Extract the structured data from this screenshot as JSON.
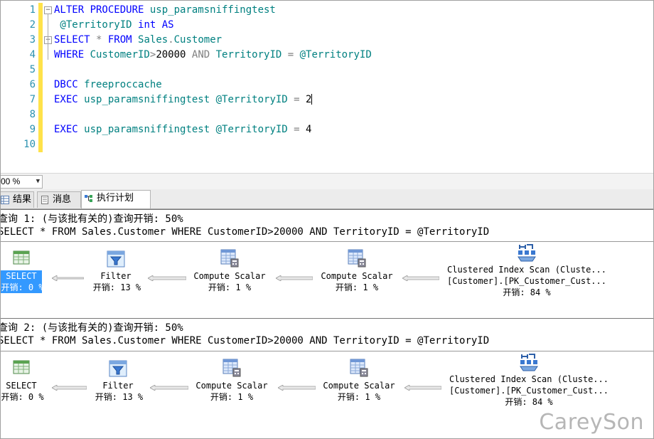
{
  "editor": {
    "line_numbers": [
      "1",
      "2",
      "3",
      "4",
      "5",
      "6",
      "7",
      "8",
      "9",
      "10"
    ],
    "lines": [
      [
        {
          "t": "ALTER PROCEDURE ",
          "c": "kw"
        },
        {
          "t": "usp_paramsniffingtest",
          "c": "id"
        }
      ],
      [
        {
          "t": " @TerritoryID ",
          "c": "id"
        },
        {
          "t": "int AS",
          "c": "kw"
        }
      ],
      [
        {
          "t": "SELECT ",
          "c": "kw"
        },
        {
          "t": "* ",
          "c": "op"
        },
        {
          "t": "FROM ",
          "c": "kw"
        },
        {
          "t": "Sales",
          "c": "id"
        },
        {
          "t": ".",
          "c": "op"
        },
        {
          "t": "Customer",
          "c": "id"
        }
      ],
      [
        {
          "t": "WHERE ",
          "c": "kw"
        },
        {
          "t": "CustomerID",
          "c": "id"
        },
        {
          "t": ">",
          "c": "op"
        },
        {
          "t": "20000 ",
          "c": "num"
        },
        {
          "t": "AND ",
          "c": "op"
        },
        {
          "t": "TerritoryID ",
          "c": "id"
        },
        {
          "t": "= ",
          "c": "op"
        },
        {
          "t": "@TerritoryID",
          "c": "id"
        }
      ],
      [],
      [
        {
          "t": "DBCC ",
          "c": "kw"
        },
        {
          "t": "freeproccache",
          "c": "id"
        }
      ],
      [
        {
          "t": "EXEC ",
          "c": "kw"
        },
        {
          "t": "usp_paramsniffingtest ",
          "c": "id"
        },
        {
          "t": "@TerritoryID ",
          "c": "id"
        },
        {
          "t": "= ",
          "c": "op"
        },
        {
          "t": "2",
          "c": "num"
        }
      ],
      [],
      [
        {
          "t": "EXEC ",
          "c": "kw"
        },
        {
          "t": "usp_paramsniffingtest ",
          "c": "id"
        },
        {
          "t": "@TerritoryID ",
          "c": "id"
        },
        {
          "t": "= ",
          "c": "op"
        },
        {
          "t": "4",
          "c": "num"
        }
      ],
      []
    ]
  },
  "zoom": {
    "value": "00 %"
  },
  "tabs": [
    {
      "label": "结果",
      "icon": "grid-icon"
    },
    {
      "label": "消息",
      "icon": "message-icon"
    },
    {
      "label": "执行计划",
      "icon": "execution-plan-icon",
      "active": true
    }
  ],
  "queries": [
    {
      "header": "查询 1: (与该批有关的)查询开销: 50%",
      "sql": "SELECT * FROM Sales.Customer WHERE CustomerID>20000 AND TerritoryID = @TerritoryID",
      "operators": [
        {
          "name": "SELECT",
          "cost": "开销: 0 %",
          "icon": "select-icon",
          "selected": true
        },
        {
          "name": "Filter",
          "cost": "开销: 13 %",
          "icon": "filter-icon"
        },
        {
          "name": "Compute Scalar",
          "cost": "开销: 1 %",
          "icon": "compute-scalar-icon"
        },
        {
          "name": "Compute Scalar",
          "cost": "开销: 1 %",
          "icon": "compute-scalar-icon"
        },
        {
          "name": "Clustered Index Scan (Cluste...",
          "name2": "[Customer].[PK_Customer_Cust...",
          "cost": "开销: 84 %",
          "icon": "clustered-index-scan-icon"
        }
      ]
    },
    {
      "header": "查询 2: (与该批有关的)查询开销: 50%",
      "sql": "SELECT * FROM Sales.Customer WHERE CustomerID>20000 AND TerritoryID = @TerritoryID",
      "operators": [
        {
          "name": "SELECT",
          "cost": "开销: 0 %",
          "icon": "select-icon"
        },
        {
          "name": "Filter",
          "cost": "开销: 13 %",
          "icon": "filter-icon"
        },
        {
          "name": "Compute Scalar",
          "cost": "开销: 1 %",
          "icon": "compute-scalar-icon"
        },
        {
          "name": "Compute Scalar",
          "cost": "开销: 1 %",
          "icon": "compute-scalar-icon"
        },
        {
          "name": "Clustered Index Scan (Cluste...",
          "name2": "[Customer].[PK_Customer_Cust...",
          "cost": "开销: 84 %",
          "icon": "clustered-index-scan-icon"
        }
      ]
    }
  ],
  "watermark": "CareySon"
}
